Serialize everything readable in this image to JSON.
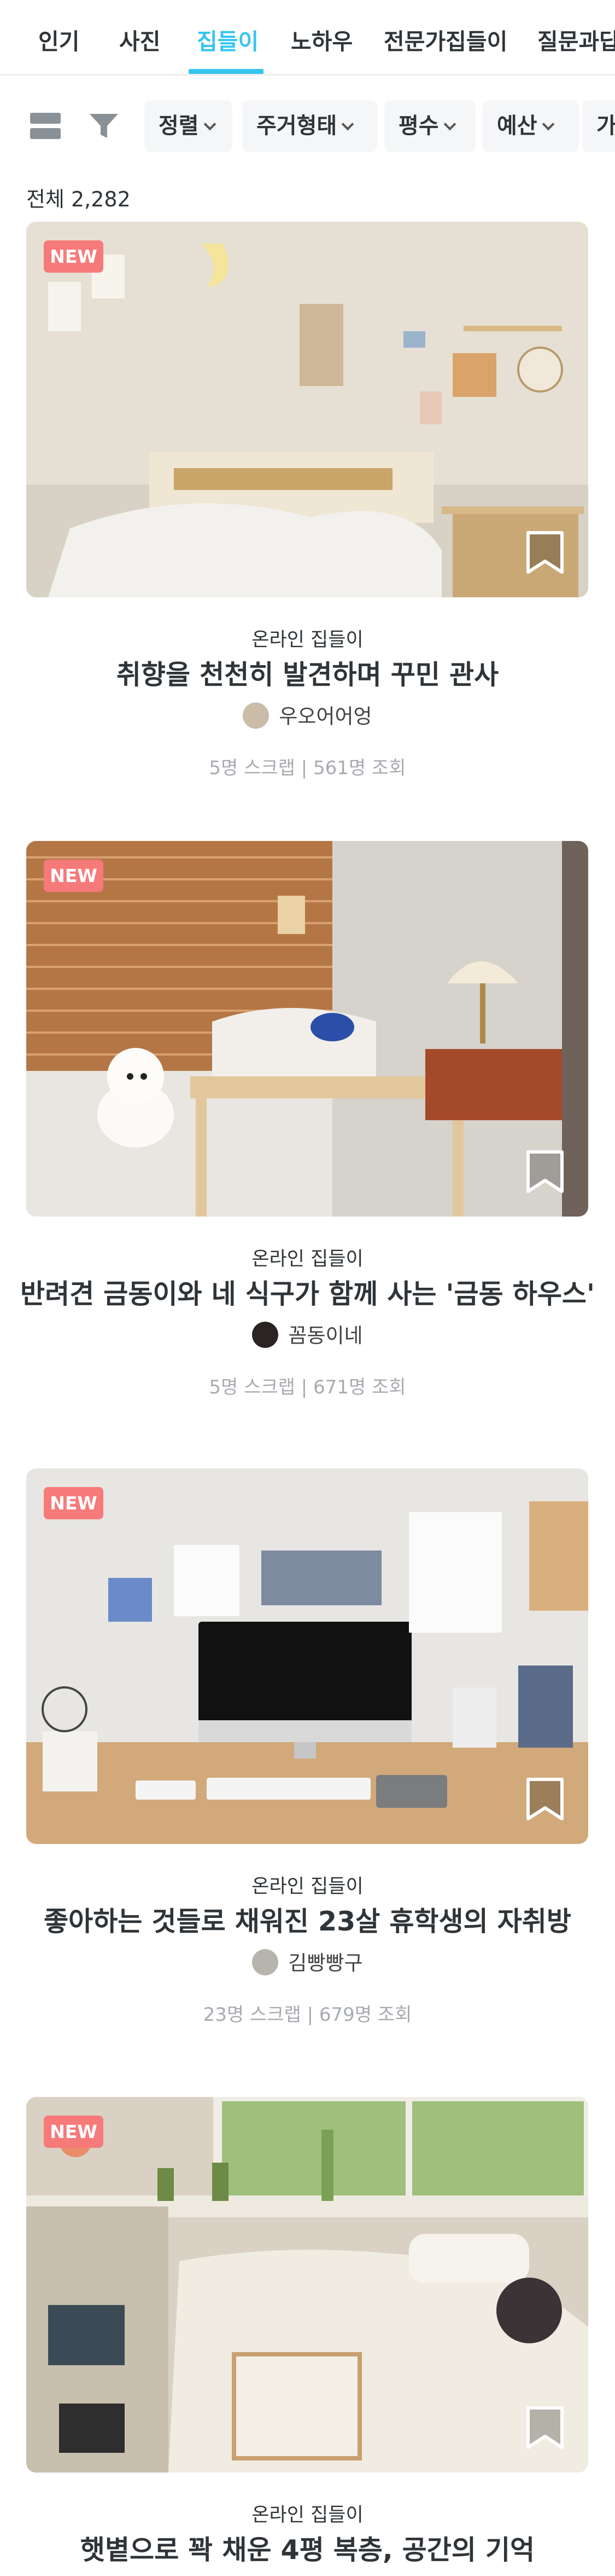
{
  "tabs": [
    {
      "label": "인기"
    },
    {
      "label": "사진"
    },
    {
      "label": "집들이"
    },
    {
      "label": "노하우"
    },
    {
      "label": "전문가집들이"
    },
    {
      "label": "질문과답"
    }
  ],
  "active_tab": "집들이",
  "filters": [
    "정렬",
    "주거형태",
    "평수",
    "예산",
    "가족형태"
  ],
  "total_count": "전체 2,282",
  "cards": [
    {
      "badge": "NEW",
      "category": "온라인 집들이",
      "title": "취향을 천천히 발견하며 꾸민 관사",
      "author": "우오어어엉",
      "stats": "5명 스크랩 | 561명 조회"
    },
    {
      "badge": "NEW",
      "category": "온라인 집들이",
      "title": "반려견 금동이와 네 식구가 함께 사는 '금동 하우스'",
      "author": "꼼동이네",
      "stats": "5명 스크랩 | 671명 조회"
    },
    {
      "badge": "NEW",
      "category": "온라인 집들이",
      "title": "좋아하는 것들로 채워진 23살 휴학생의 자취방",
      "author": "김빵빵구",
      "stats": "23명 스크랩 | 679명 조회"
    },
    {
      "badge": "NEW",
      "category": "온라인 집들이",
      "title": "햇볕으로 꽉 채운 4평 복층, 공간의 기억"
    }
  ],
  "colors": {
    "accent": "#35c5f0",
    "badge": "#f77a7a",
    "muted_text": "#a7abb0"
  },
  "icons": [
    "grid-view-icon",
    "filter-icon",
    "chevron-down-icon",
    "bookmark-icon"
  ]
}
